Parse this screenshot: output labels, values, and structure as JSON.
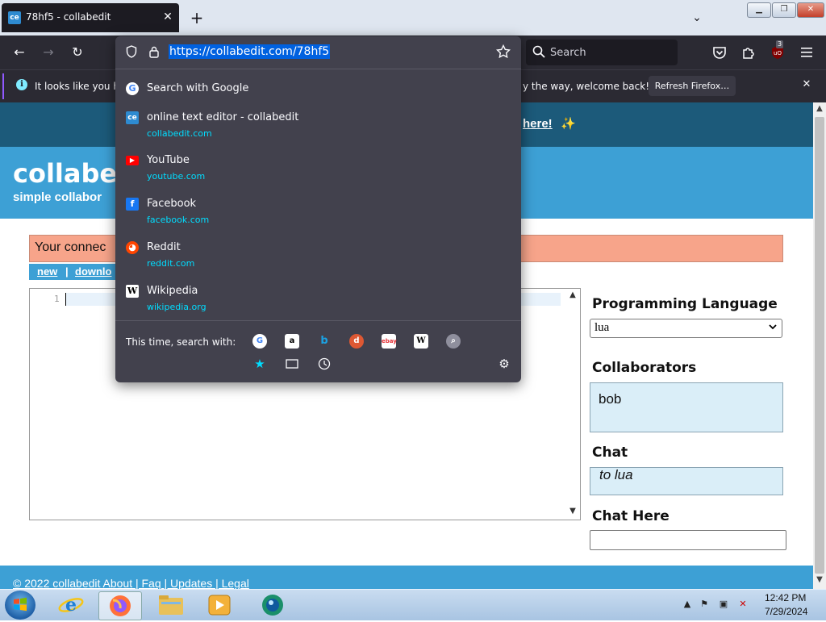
{
  "browser": {
    "tab": {
      "favicon_text": "ce",
      "title": "78hf5 - collabedit",
      "close": "✕"
    },
    "new_tab": "+",
    "tab_list": "⌄",
    "window_buttons": {
      "minimize": "▁",
      "maximize": "❐",
      "close": "✕"
    },
    "nav": {
      "back": "←",
      "forward": "→",
      "reload": "↻"
    },
    "search_placeholder": "Search",
    "toolbar_icons": [
      "pocket-icon",
      "extensions-icon",
      "ublock-icon",
      "menu-icon"
    ],
    "badge_count": "3",
    "notification": {
      "text_left": "It looks like you ha",
      "text_right": "y the way, welcome back!",
      "button": "Refresh Firefox…",
      "close": "✕"
    }
  },
  "urlbar": {
    "url": "https://collabedit.com/78hf5",
    "suggestions": [
      {
        "icon": "google-icon",
        "title": "Search with Google",
        "url": ""
      },
      {
        "icon": "collabedit-icon",
        "title": "online text editor - collabedit",
        "url": "collabedit.com"
      },
      {
        "icon": "youtube-icon",
        "title": "YouTube",
        "url": "youtube.com"
      },
      {
        "icon": "facebook-icon",
        "title": "Facebook",
        "url": "facebook.com"
      },
      {
        "icon": "reddit-icon",
        "title": "Reddit",
        "url": "reddit.com"
      },
      {
        "icon": "wikipedia-icon",
        "title": "Wikipedia",
        "url": "wikipedia.org"
      }
    ],
    "one_off_label": "This time, search with:",
    "engines": [
      "google-icon",
      "amazon-icon",
      "bing-icon",
      "duckduckgo-icon",
      "ebay-icon",
      "wikipedia-icon",
      "search-icon"
    ],
    "modes": [
      "bookmarks-icon",
      "tabs-icon",
      "history-icon"
    ]
  },
  "page": {
    "announce_link": "here!",
    "announce_emoji": "✨",
    "logo": "collabe",
    "logo_sub": "simple collabor",
    "connection_text": "Your connec",
    "links": {
      "new": "new",
      "sep": "|",
      "download": "downlo"
    },
    "editor": {
      "line_number": "1"
    },
    "programming_language_label": "Programming Language",
    "language_value": "lua",
    "collaborators_label": "Collaborators",
    "collaborators": [
      "bob"
    ],
    "chat_label": "Chat",
    "chat_message": "to lua",
    "chat_here_label": "Chat Here",
    "footer": "© 2022 collabedit   About   |   Faq   |   Updates   |   Legal"
  },
  "taskbar": {
    "items": [
      "ie-icon",
      "firefox-icon",
      "explorer-icon",
      "media-player-icon",
      "app-icon"
    ],
    "clock_time": "12:42 PM",
    "clock_date": "7/29/2024"
  },
  "colors": {
    "browser_dark": "#2b2a33",
    "panel": "#42414d",
    "url_highlight": "#0061e0",
    "link_cyan": "#00ddff",
    "site_blue": "#3da0d5",
    "site_banner": "#1c5a7a",
    "connection_salmon": "#f7a48a",
    "light_panel": "#daeef8"
  }
}
